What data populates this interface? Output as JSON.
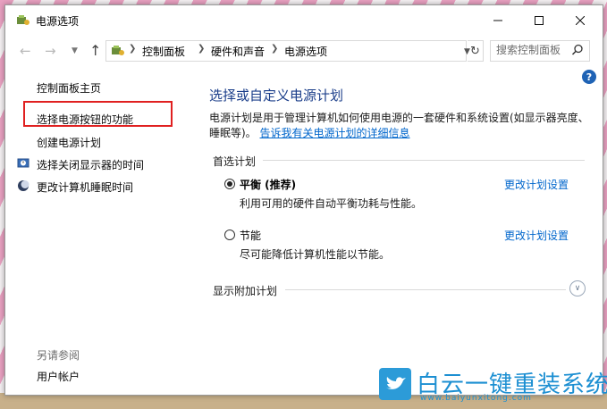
{
  "window": {
    "title": "电源选项"
  },
  "nav": {
    "breadcrumb": [
      "控制面板",
      "硬件和声音",
      "电源选项"
    ],
    "search_placeholder": "搜索控制面板"
  },
  "sidebar": {
    "items": [
      {
        "label": "控制面板主页"
      },
      {
        "label": "选择电源按钮的功能"
      },
      {
        "label": "创建电源计划"
      },
      {
        "label": "选择关闭显示器的时间"
      },
      {
        "label": "更改计算机睡眠时间"
      }
    ],
    "see_also_label": "另请参阅",
    "see_also_items": [
      {
        "label": "用户帐户"
      }
    ]
  },
  "main": {
    "title": "选择或自定义电源计划",
    "description": "电源计划是用于管理计算机如何使用电源的一套硬件和系统设置(如显示器亮度、睡眠等)。",
    "description_link": "告诉我有关电源计划的详细信息",
    "preferred_label": "首选计划",
    "plans": [
      {
        "name": "平衡 (推荐)",
        "description": "利用可用的硬件自动平衡功耗与性能。",
        "link": "更改计划设置",
        "selected": true
      },
      {
        "name": "节能",
        "description": "尽可能降低计算机性能以节能。",
        "link": "更改计划设置",
        "selected": false
      }
    ],
    "additional_label": "显示附加计划"
  },
  "watermark": {
    "brand": "白云一键重装系统",
    "url": "www.baiyunxitong.com"
  },
  "colors": {
    "title_blue": "#1b3e8a",
    "link_blue": "#0066cc",
    "highlight_red": "#e02020"
  }
}
